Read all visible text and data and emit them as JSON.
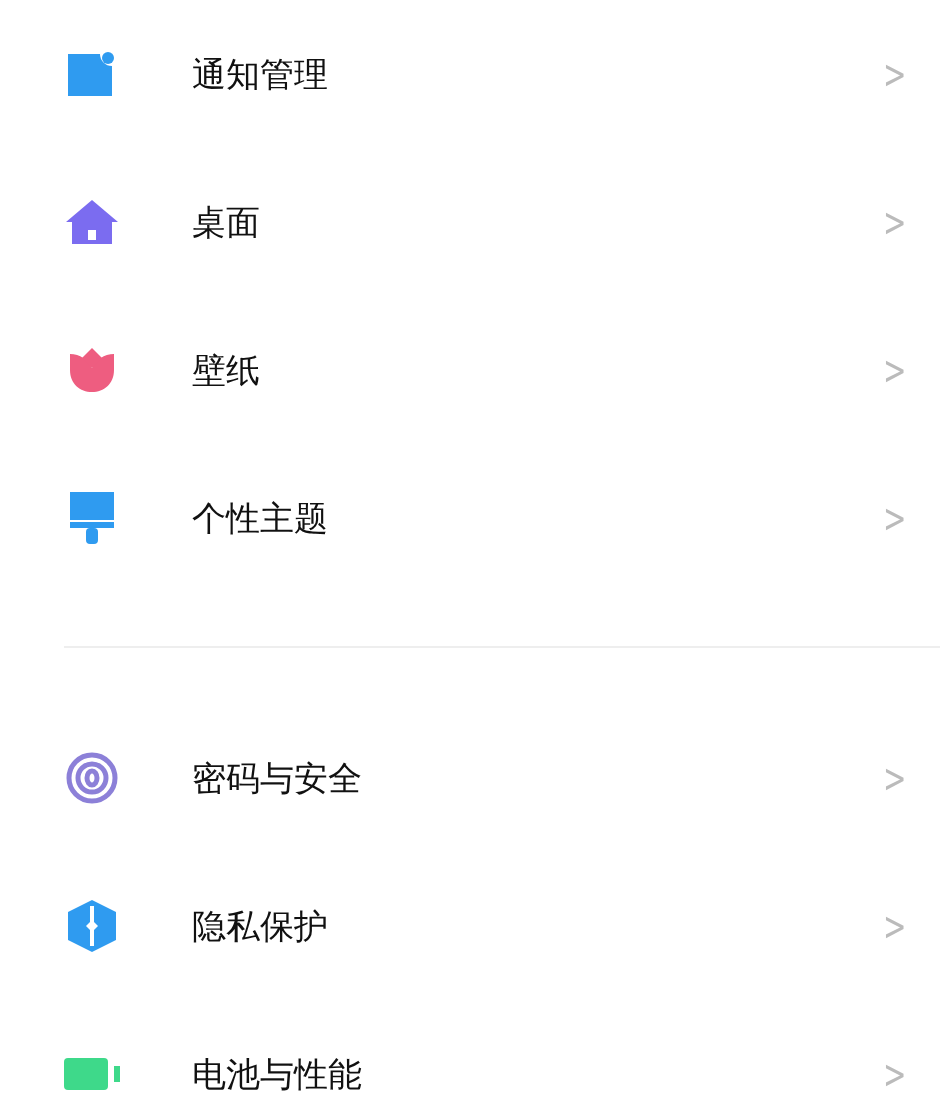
{
  "groups": [
    {
      "items": [
        {
          "kind": "notification",
          "label": "通知管理",
          "chevron": ">"
        },
        {
          "kind": "home",
          "label": "桌面",
          "chevron": ">"
        },
        {
          "kind": "tulip",
          "label": "壁纸",
          "chevron": ">"
        },
        {
          "kind": "brush",
          "label": "个性主题",
          "chevron": ">"
        }
      ]
    },
    {
      "items": [
        {
          "kind": "fingerprint",
          "label": "密码与安全",
          "chevron": ">"
        },
        {
          "kind": "shield",
          "label": "隐私保护",
          "chevron": ">"
        },
        {
          "kind": "battery",
          "label": "电池与性能",
          "chevron": ">"
        }
      ]
    }
  ]
}
